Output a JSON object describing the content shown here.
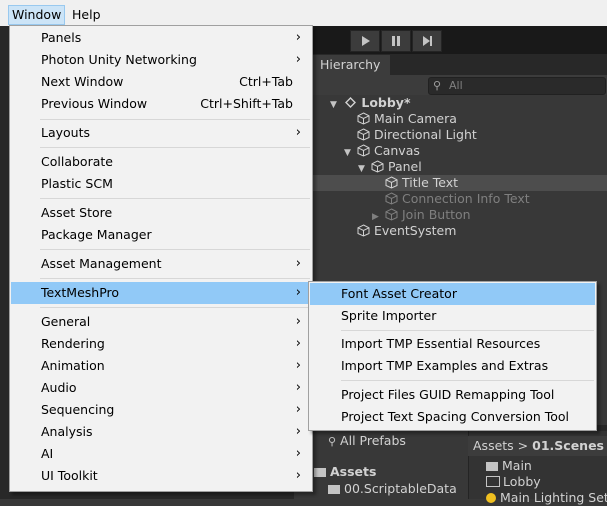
{
  "menubar": {
    "items": [
      {
        "label": "Window",
        "active": true
      },
      {
        "label": "Help",
        "active": false
      }
    ]
  },
  "toolbar": {
    "play_icon": "play-icon",
    "pause_icon": "pause-icon",
    "step_icon": "step-icon"
  },
  "hierarchy": {
    "tab_label": "Hierarchy",
    "search_placeholder": "All",
    "rows": [
      {
        "label": "Lobby*",
        "dim": false
      },
      {
        "label": "Main Camera",
        "dim": false
      },
      {
        "label": "Directional Light",
        "dim": false
      },
      {
        "label": "Canvas",
        "dim": false
      },
      {
        "label": "Panel",
        "dim": false
      },
      {
        "label": "Title Text",
        "dim": false
      },
      {
        "label": "Connection Info Text",
        "dim": true
      },
      {
        "label": "Join Button",
        "dim": true
      },
      {
        "label": "EventSystem",
        "dim": false
      }
    ]
  },
  "project": {
    "favorites_label": "All Prefabs",
    "assets_label": "Assets",
    "scriptable_label": "00.ScriptableData",
    "breadcrumb_root": "Assets",
    "breadcrumb_sep": ">",
    "breadcrumb_current": "01.Scenes",
    "files": [
      "Main",
      "Lobby",
      "Main Lighting Setti"
    ]
  },
  "window_menu": {
    "items": [
      {
        "label": "Panels",
        "shortcut": "",
        "submenu": true
      },
      {
        "label": "Photon Unity Networking",
        "shortcut": "",
        "submenu": true
      },
      {
        "label": "Next Window",
        "shortcut": "Ctrl+Tab",
        "submenu": false
      },
      {
        "label": "Previous Window",
        "shortcut": "Ctrl+Shift+Tab",
        "submenu": false
      },
      {
        "label": "Layouts",
        "shortcut": "",
        "submenu": true
      },
      {
        "label": "Collaborate",
        "shortcut": "",
        "submenu": false
      },
      {
        "label": "Plastic SCM",
        "shortcut": "",
        "submenu": false
      },
      {
        "label": "Asset Store",
        "shortcut": "",
        "submenu": false
      },
      {
        "label": "Package Manager",
        "shortcut": "",
        "submenu": false
      },
      {
        "label": "Asset Management",
        "shortcut": "",
        "submenu": true
      },
      {
        "label": "TextMeshPro",
        "shortcut": "",
        "submenu": true,
        "highlighted": true
      },
      {
        "label": "General",
        "shortcut": "",
        "submenu": true
      },
      {
        "label": "Rendering",
        "shortcut": "",
        "submenu": true
      },
      {
        "label": "Animation",
        "shortcut": "",
        "submenu": true
      },
      {
        "label": "Audio",
        "shortcut": "",
        "submenu": true
      },
      {
        "label": "Sequencing",
        "shortcut": "",
        "submenu": true
      },
      {
        "label": "Analysis",
        "shortcut": "",
        "submenu": true
      },
      {
        "label": "AI",
        "shortcut": "",
        "submenu": true
      },
      {
        "label": "UI Toolkit",
        "shortcut": "",
        "submenu": true
      }
    ]
  },
  "textmeshpro_submenu": {
    "items": [
      {
        "label": "Font Asset Creator",
        "highlighted": true
      },
      {
        "label": "Sprite Importer",
        "highlighted": false
      },
      {
        "label": "Import TMP Essential Resources",
        "highlighted": false
      },
      {
        "label": "Import TMP Examples and Extras",
        "highlighted": false
      },
      {
        "label": "Project Files GUID Remapping Tool",
        "highlighted": false
      },
      {
        "label": "Project Text Spacing Conversion Tool",
        "highlighted": false
      }
    ]
  },
  "colors": {
    "menu_highlight": "#91c9f7",
    "menubar_active": "#cce4f7",
    "editor_dark": "#383838"
  }
}
